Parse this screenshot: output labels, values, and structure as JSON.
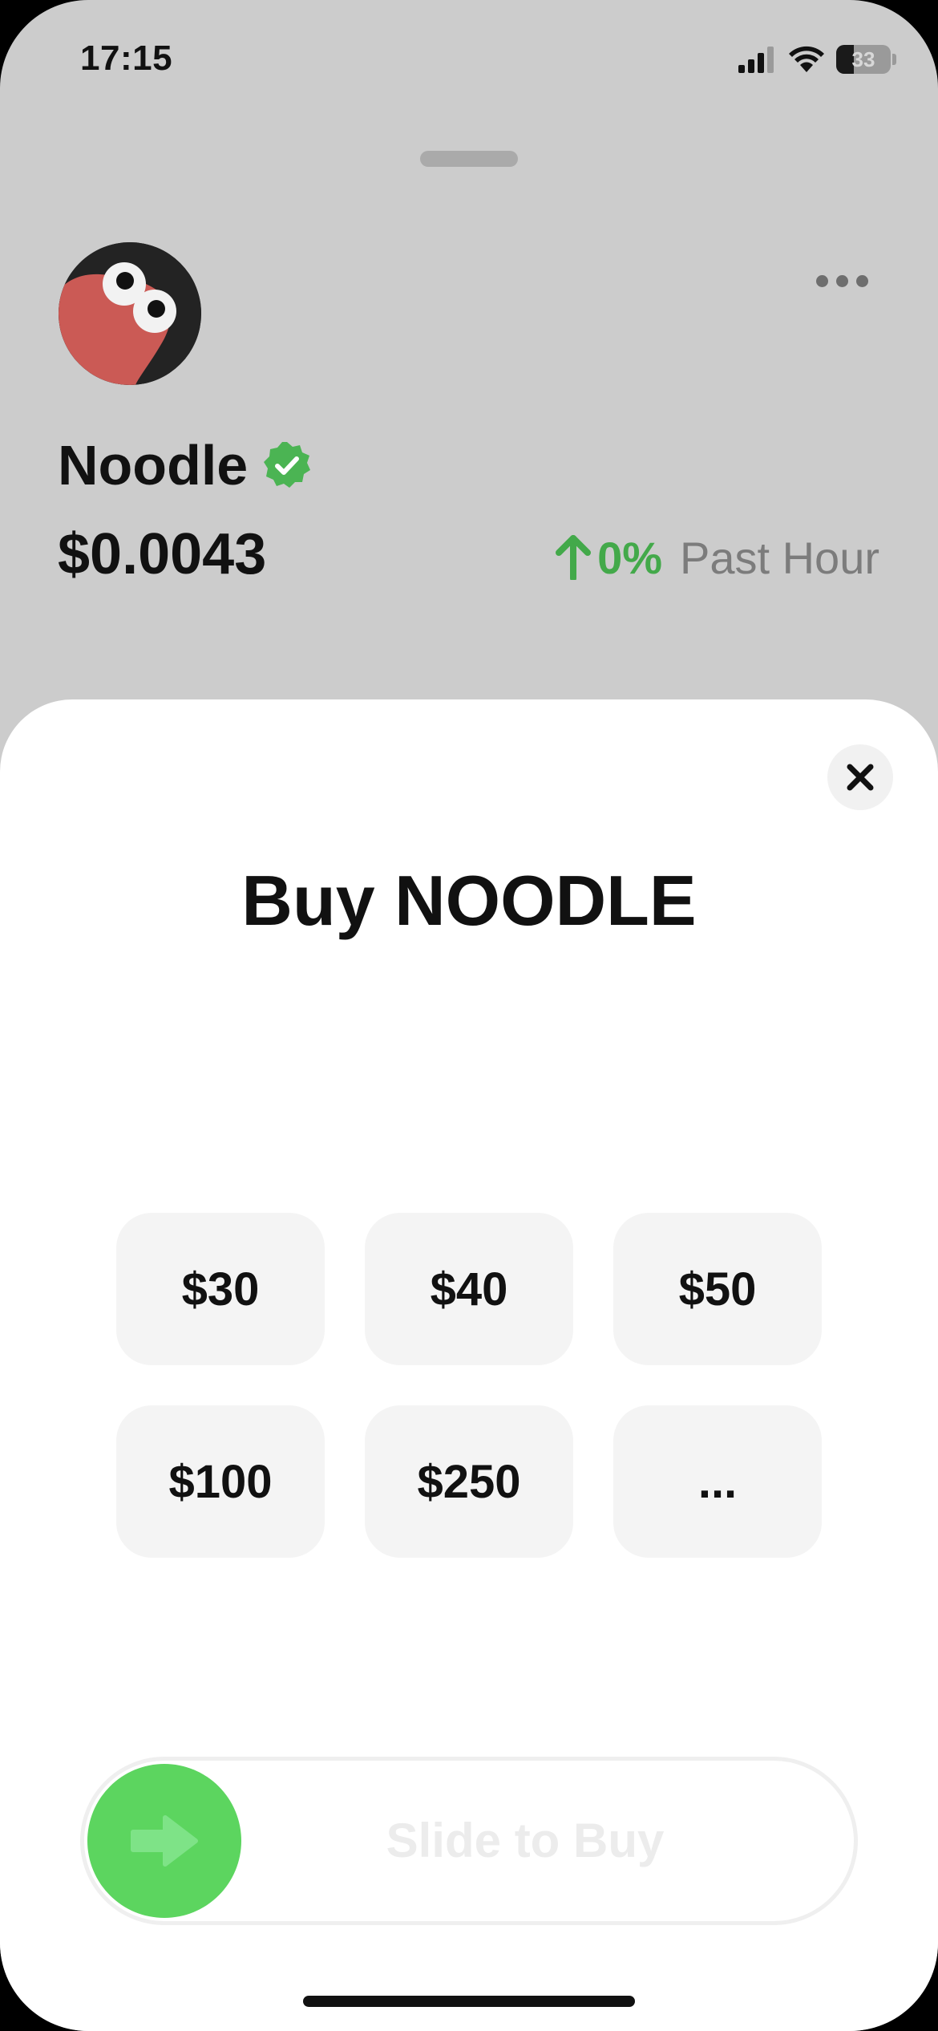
{
  "status_bar": {
    "time": "17:15",
    "battery_level": "33",
    "battery_fraction": 0.33,
    "icons": [
      "cellular-signal-icon",
      "wifi-icon",
      "battery-icon"
    ]
  },
  "token": {
    "name": "Noodle",
    "verified_icon": "verified-check-icon",
    "price": "$0.0043",
    "change_arrow_icon": "arrow-up-icon",
    "change_value": "0%",
    "change_period": "Past Hour"
  },
  "header": {
    "more_icon": "more-horizontal-icon"
  },
  "sheet": {
    "close_icon": "close-icon",
    "title": "Buy NOODLE",
    "amounts": [
      "$30",
      "$40",
      "$50",
      "$100",
      "$250",
      "..."
    ],
    "slider_label": "Slide to Buy",
    "slider_icon": "arrow-right-icon"
  },
  "colors": {
    "background_dim": "#cccccc",
    "accent_green": "#43a94a",
    "slider_green": "#5cd55f",
    "sheet": "#ffffff",
    "button_bg": "#f4f4f4"
  }
}
